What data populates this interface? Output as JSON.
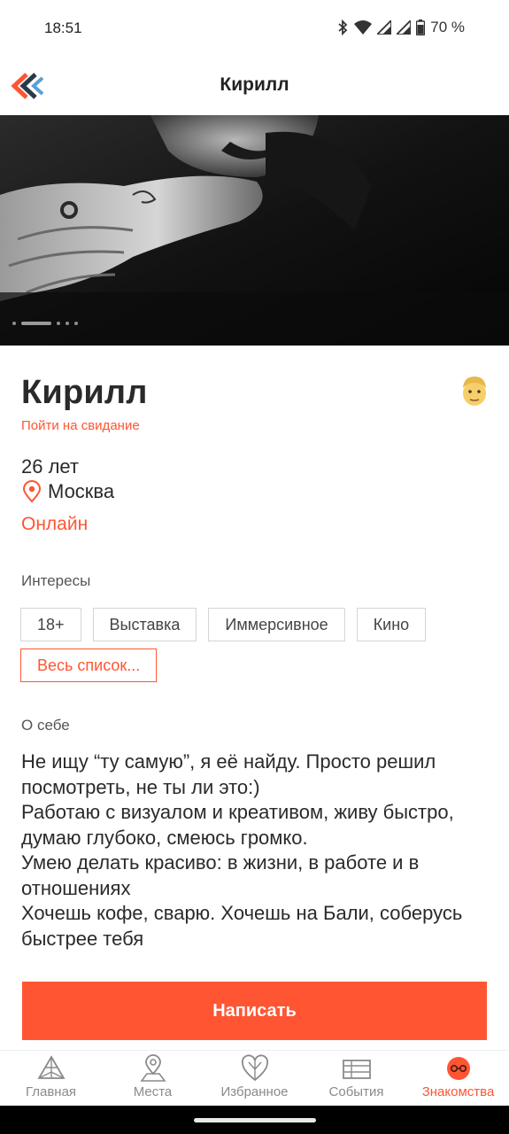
{
  "status_bar": {
    "time": "18:51",
    "battery_percent": "70 %",
    "icons": [
      "bluetooth-icon",
      "wifi-icon",
      "signal-icon",
      "signal-icon",
      "battery-icon"
    ]
  },
  "app_bar": {
    "title": "Кирилл",
    "back_icon": "double-chevron-left-icon"
  },
  "photo": {
    "slide_count": 5,
    "active_slide": 2
  },
  "profile": {
    "name": "Кирилл",
    "date_link": "Пойти на свидание",
    "age": "26 лет",
    "city": "Москва",
    "status": "Онлайн"
  },
  "interests": {
    "label": "Интересы",
    "items": [
      "18+",
      "Выставка",
      "Иммерсивное",
      "Кино"
    ],
    "more_label": "Весь список..."
  },
  "about": {
    "label": "О себе",
    "text": "Не ищу “ту самую”,  я её найду. Просто решил посмотреть, не ты ли это:)\nРаботаю с визуалом и креативом, живу быстро, думаю глубоко, смеюсь громко.\nУмею делать красиво: в жизни, в работе и в отношениях\nХочешь кофе, сварю. Хочешь на Бали, соберусь быстрее тебя"
  },
  "cta": {
    "label": "Написать"
  },
  "tabs": [
    {
      "label": "Главная",
      "icon": "home-pyramid-icon",
      "active": false
    },
    {
      "label": "Места",
      "icon": "map-pin-icon",
      "active": false
    },
    {
      "label": "Избранное",
      "icon": "heart-icon",
      "active": false
    },
    {
      "label": "События",
      "icon": "events-icon",
      "active": false
    },
    {
      "label": "Знакомства",
      "icon": "dating-icon",
      "active": true
    }
  ],
  "colors": {
    "accent": "#ff5533",
    "text": "#2a2a2a",
    "muted": "#8a8a8a"
  }
}
